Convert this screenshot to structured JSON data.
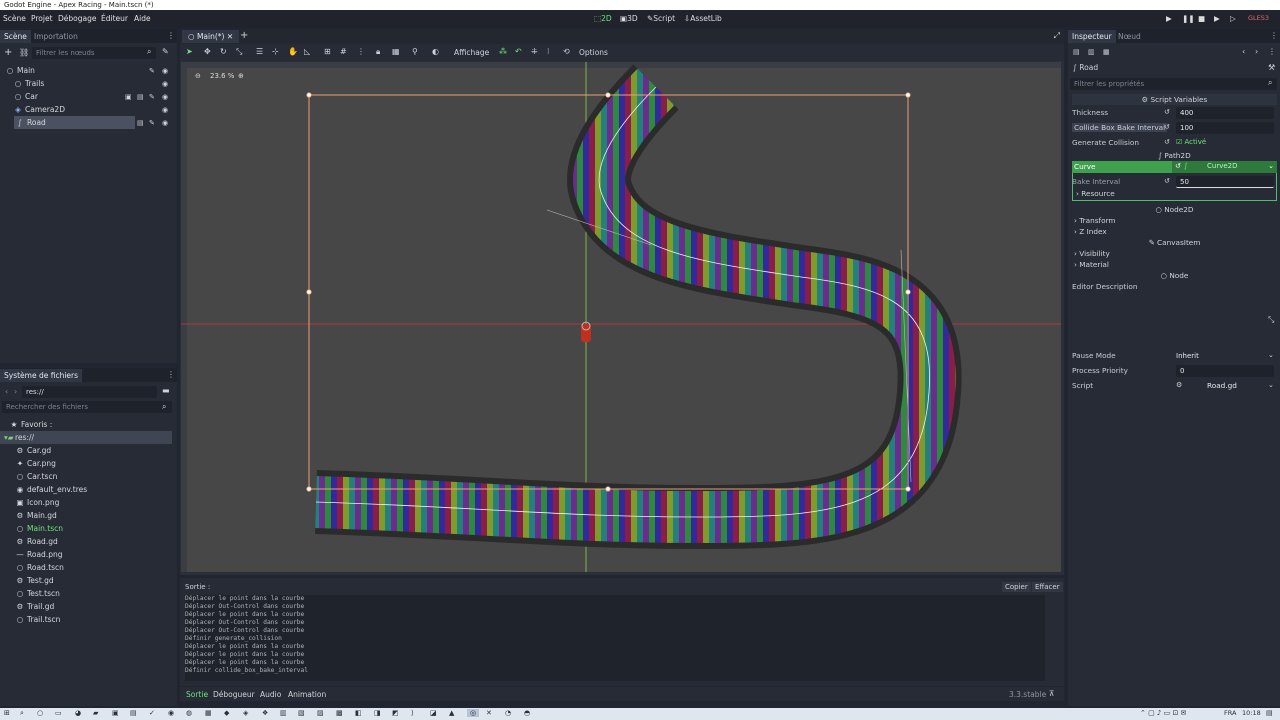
{
  "window": {
    "title": "Godot Engine - Apex Racing - Main.tscn (*)",
    "controls": [
      "—",
      "□",
      "✕"
    ]
  },
  "menu": {
    "items": [
      "Scène",
      "Projet",
      "Débogage",
      "Éditeur",
      "Aide"
    ]
  },
  "workspaces": {
    "items": [
      "2D",
      "3D",
      "Script",
      "AssetLib"
    ],
    "active": "2D"
  },
  "play_controls": {
    "renderer": "GLES3"
  },
  "scene_dock": {
    "tabs": [
      "Scène",
      "Importation"
    ],
    "filter_placeholder": "Filtrer les nœuds",
    "nodes": [
      {
        "name": "Main",
        "icon": "○"
      },
      {
        "name": "Trails",
        "icon": "○"
      },
      {
        "name": "Car",
        "icon": "○"
      },
      {
        "name": "Camera2D",
        "icon": "◈"
      },
      {
        "name": "Road",
        "icon": "∫",
        "selected": true
      }
    ]
  },
  "filesystem": {
    "title": "Système de fichiers",
    "path": "res://",
    "search_placeholder": "Rechercher des fichiers",
    "favorites": "Favoris :",
    "root": "res://",
    "files": [
      {
        "name": "Car.gd",
        "icon": "⚙"
      },
      {
        "name": "Car.png",
        "icon": "✦"
      },
      {
        "name": "Car.tscn",
        "icon": "○"
      },
      {
        "name": "default_env.tres",
        "icon": "◉"
      },
      {
        "name": "Icon.png",
        "icon": "▣"
      },
      {
        "name": "Main.gd",
        "icon": "⚙"
      },
      {
        "name": "Main.tscn",
        "icon": "○",
        "highlight": true
      },
      {
        "name": "Road.gd",
        "icon": "⚙"
      },
      {
        "name": "Road.png",
        "icon": "—"
      },
      {
        "name": "Road.tscn",
        "icon": "○"
      },
      {
        "name": "Test.gd",
        "icon": "⚙"
      },
      {
        "name": "Test.tscn",
        "icon": "○"
      },
      {
        "name": "Trail.gd",
        "icon": "⚙"
      },
      {
        "name": "Trail.tscn",
        "icon": "○"
      }
    ]
  },
  "viewport": {
    "tab": "Main(*)",
    "zoom": "23.6 %",
    "toolbar": {
      "view_label": "Affichage",
      "options_label": "Options"
    }
  },
  "output": {
    "title": "Sortie :",
    "copy_label": "Copier",
    "clear_label": "Effacer",
    "lines": [
      "Déplacer le point dans la courbe",
      "Déplacer Out-Control dans courbe",
      "Déplacer le point dans la courbe",
      "Déplacer Out-Control dans courbe",
      "Déplacer Out-Control dans courbe",
      "Définir generate_collision",
      "Déplacer le point dans la courbe",
      "Déplacer le point dans la courbe",
      "Déplacer le point dans la courbe",
      "Définir collide_box_bake_interval"
    ],
    "bottom_tabs": [
      "Sortie",
      "Débogueur",
      "Audio",
      "Animation"
    ],
    "version": "3.3.stable"
  },
  "inspector": {
    "tabs": [
      "Inspecteur",
      "Nœud"
    ],
    "node_name": "Road",
    "filter_placeholder": "Filtrer les propriétés",
    "script_vars_title": "Script Variables",
    "props": [
      {
        "label": "Thickness",
        "value": "400"
      },
      {
        "label": "Collide Box Bake Interval",
        "value": "100"
      },
      {
        "label": "Generate Collision",
        "value": "Activé"
      }
    ],
    "path2d_title": "Path2D",
    "curve_label": "Curve",
    "curve_value": "Curve2D",
    "bake_label": "Bake Interval",
    "bake_value": "50",
    "resource_label": "Resource",
    "node2d_title": "Node2D",
    "transform_label": "Transform",
    "zindex_label": "Z Index",
    "canvasitem_title": "CanvasItem",
    "visibility_label": "Visibility",
    "material_label": "Material",
    "node_title": "Node",
    "editor_desc_label": "Editor Description",
    "pause_label": "Pause Mode",
    "pause_value": "Inherit",
    "priority_label": "Process Priority",
    "priority_value": "0",
    "script_label": "Script",
    "script_value": "Road.gd"
  },
  "taskbar": {
    "lang": "FRA",
    "time": "10:18"
  },
  "colors": {
    "accent": "#6ee57a",
    "canvas_bg": "#474747",
    "road_border": "#2b2b2b",
    "selection": "#e8a277",
    "axis_x": "#b03a3a",
    "axis_y": "#7fb446"
  }
}
